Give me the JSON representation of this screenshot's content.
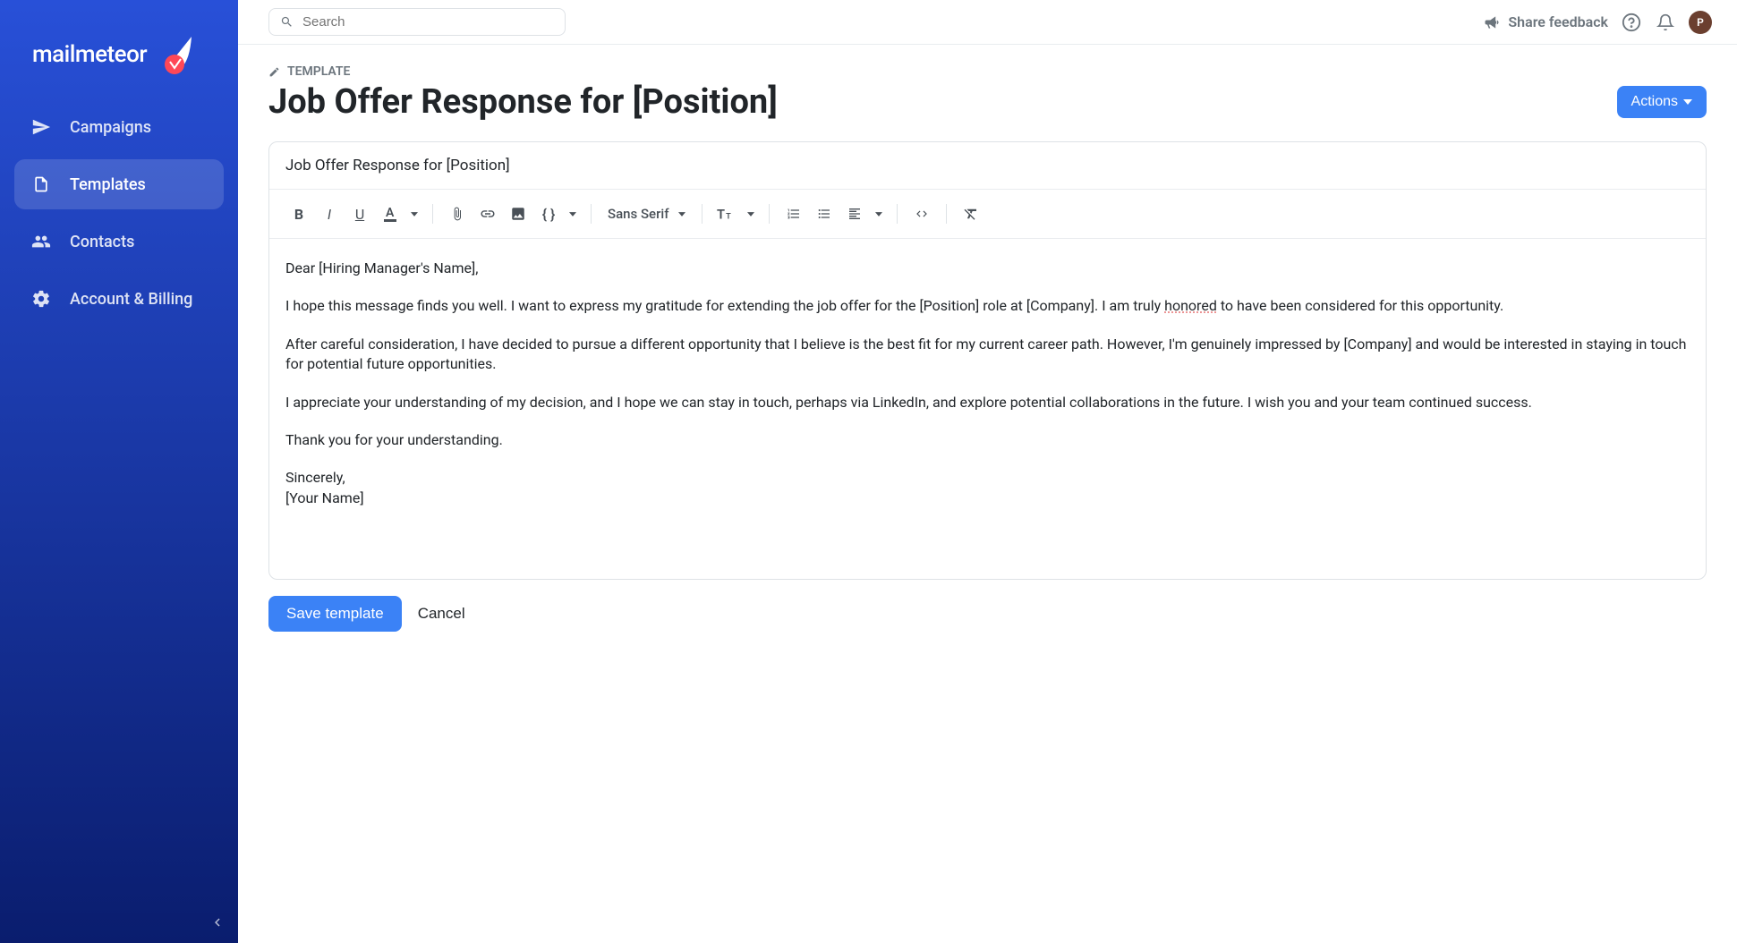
{
  "brand": {
    "name": "mailmeteor"
  },
  "sidebar": {
    "items": [
      {
        "label": "Campaigns"
      },
      {
        "label": "Templates"
      },
      {
        "label": "Contacts"
      },
      {
        "label": "Account & Billing"
      }
    ]
  },
  "topbar": {
    "search_placeholder": "Search",
    "feedback_label": "Share feedback",
    "avatar_initial": "P"
  },
  "page": {
    "breadcrumb": "TEMPLATE",
    "title": "Job Offer Response for [Position]",
    "actions_label": "Actions"
  },
  "editor": {
    "subject": "Job Offer Response for [Position]",
    "font_label": "Sans Serif",
    "body": {
      "p1": "Dear [Hiring Manager's Name],",
      "p2a": "I hope this message finds you well. I want to express my gratitude for extending the job offer for the [Position] role at [Company]. I am truly ",
      "p2b": "honored",
      "p2c": " to have been considered for this opportunity.",
      "p3": "After careful consideration, I have decided to pursue a different opportunity that I believe is the best fit for my current career path. However, I'm genuinely impressed by [Company] and would be interested in staying in touch for potential future opportunities.",
      "p4": "I appreciate your understanding of my decision, and I hope we can stay in touch, perhaps via LinkedIn, and explore potential collaborations in the future. I wish you and your team continued success.",
      "p5": "Thank you for your understanding.",
      "p6": "Sincerely,",
      "p7": "[Your Name]"
    }
  },
  "footer": {
    "save_label": "Save template",
    "cancel_label": "Cancel"
  }
}
